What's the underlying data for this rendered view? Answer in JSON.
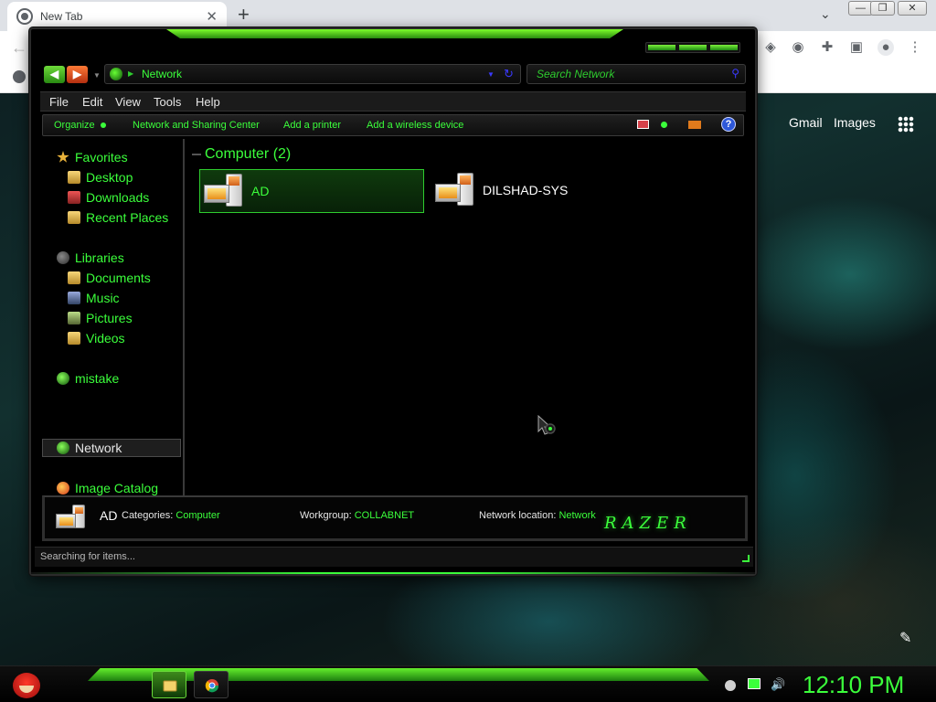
{
  "browser": {
    "tab_title": "New Tab",
    "tab_close": "✕",
    "new_tab": "+",
    "tab_search": "⌄",
    "window_buttons": {
      "minimize": "—",
      "restore": "❐",
      "close": "✕"
    },
    "google_links": {
      "gmail": "Gmail",
      "images": "Images"
    }
  },
  "explorer": {
    "address": "Network",
    "search_placeholder": "Search Network",
    "menu": [
      "File",
      "Edit",
      "View",
      "Tools",
      "Help"
    ],
    "commands": [
      "Organize",
      "Network and Sharing Center",
      "Add a printer",
      "Add a wireless device"
    ],
    "nav_pane": {
      "favorites": "Favorites",
      "favorites_items": [
        "Desktop",
        "Downloads",
        "Recent Places"
      ],
      "libraries": "Libraries",
      "libraries_items": [
        "Documents",
        "Music",
        "Pictures",
        "Videos"
      ],
      "homegroup": "mistake",
      "network": "Network",
      "catalog": "Image Catalog"
    },
    "group_header": "Computer (2)",
    "computers": [
      {
        "name": "AD",
        "selected": true
      },
      {
        "name": "DILSHAD-SYS",
        "selected": false
      }
    ],
    "details": {
      "name": "AD",
      "categories_label": "Categories:",
      "categories_value": "Computer",
      "workgroup_label": "Workgroup:",
      "workgroup_value": "COLLABNET",
      "location_label": "Network location:",
      "location_value": "Network",
      "brand": "RAZER"
    },
    "status": "Searching for items..."
  },
  "taskbar": {
    "clock": "12:10 PM"
  },
  "colors": {
    "accent_green": "#3bff3b",
    "window_bg": "#000000",
    "orange_nav": "#b42f10"
  }
}
